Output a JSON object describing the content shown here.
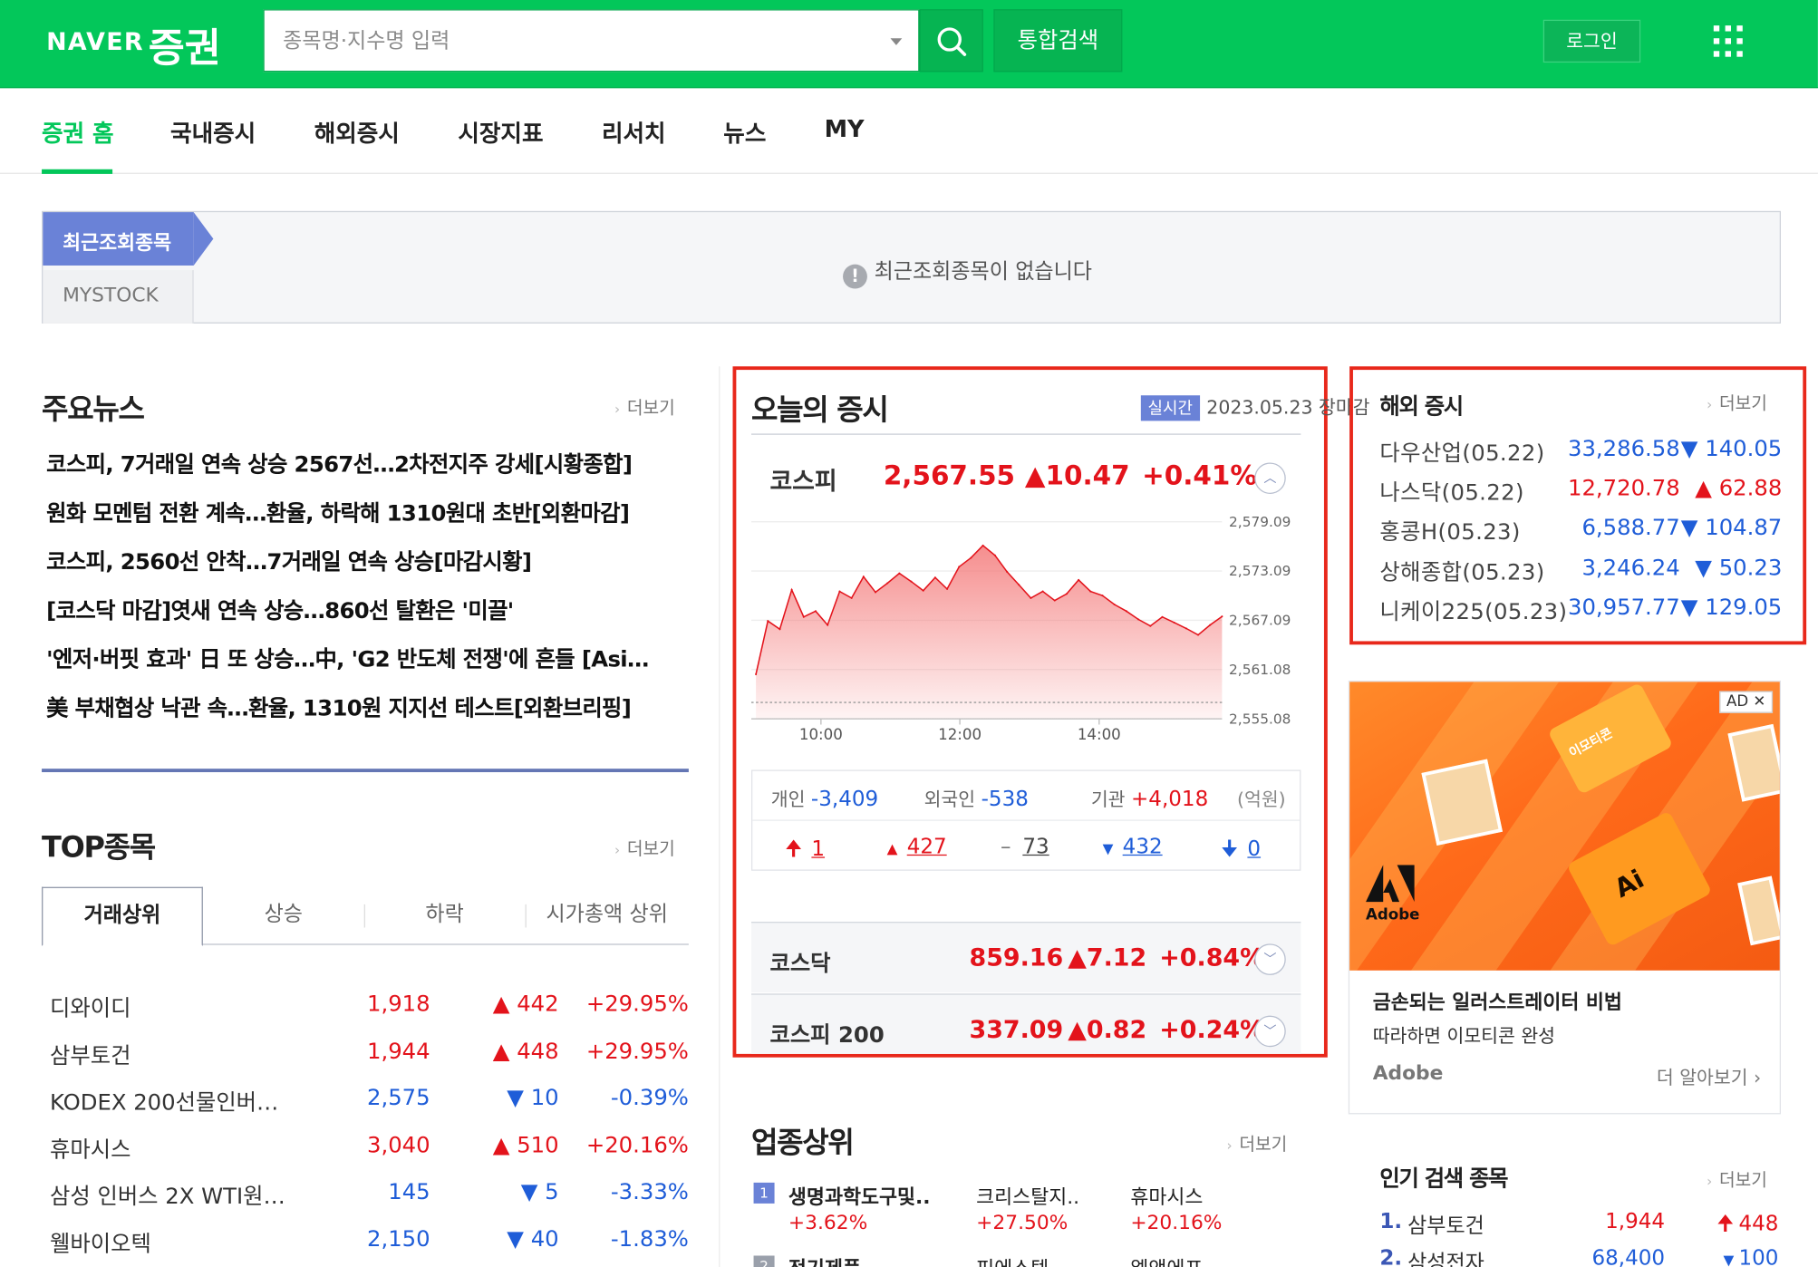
{
  "header": {
    "logo_naver": "NAVER",
    "logo_service": "증권",
    "search_placeholder": "종목명·지수명 입력",
    "integrated_search": "통합검색",
    "login": "로그인"
  },
  "nav": {
    "tabs": [
      "증권 홈",
      "국내증시",
      "해외증시",
      "시장지표",
      "리서치",
      "뉴스",
      "MY"
    ],
    "active": "증권 홈"
  },
  "recent": {
    "tab_recent": "최근조회종목",
    "tab_mystock": "MYSTOCK",
    "empty_message": "최근조회종목이 없습니다"
  },
  "news": {
    "title": "주요뉴스",
    "more": "더보기",
    "items": [
      "코스피, 7거래일 연속 상승 2567선…2차전지주 강세[시황종합]",
      "원화 모멘텀 전환 계속…환율, 하락해 1310원대 초반[외환마감]",
      "코스피, 2560선 안착…7거래일 연속 상승[마감시황]",
      "[코스닥 마감]엿새 연속 상승…860선 탈환은 '미끌'",
      "'엔저·버핏 효과' 日 또 상승…中, 'G2 반도체 전쟁'에 흔들 [Asi…",
      "美 부채협상 낙관 속…환율, 1310원 지지선 테스트[외환브리핑]"
    ]
  },
  "top": {
    "title": "TOP종목",
    "more": "더보기",
    "tabs": [
      "거래상위",
      "상승",
      "하락",
      "시가총액 상위"
    ],
    "rows": [
      {
        "name": "디와이디",
        "price": "1,918",
        "change": "▲ 442",
        "rate": "+29.95%",
        "dir": "up"
      },
      {
        "name": "삼부토건",
        "price": "1,944",
        "change": "▲ 448",
        "rate": "+29.95%",
        "dir": "up"
      },
      {
        "name": "KODEX 200선물인버…",
        "price": "2,575",
        "change": "▼ 10",
        "rate": "-0.39%",
        "dir": "down"
      },
      {
        "name": "휴마시스",
        "price": "3,040",
        "change": "▲ 510",
        "rate": "+20.16%",
        "dir": "up"
      },
      {
        "name": "삼성 인버스 2X WTI원…",
        "price": "145",
        "change": "▼ 5",
        "rate": "-3.33%",
        "dir": "down"
      },
      {
        "name": "웰바이오텍",
        "price": "2,150",
        "change": "▼ 40",
        "rate": "-1.83%",
        "dir": "down"
      }
    ]
  },
  "today": {
    "title": "오늘의 증시",
    "realtime_badge": "실시간",
    "date": "2023.05.23",
    "status": "장마감",
    "kospi": {
      "name": "코스피",
      "value": "2,567.55",
      "change": "▲10.47",
      "rate": "+0.41%"
    },
    "flow": {
      "individual_label": "개인",
      "individual": "-3,409",
      "foreign_label": "외국인",
      "foreign": "-538",
      "institution_label": "기관",
      "institution": "+4,018",
      "unit": "(억원)"
    },
    "counts": {
      "upper_limit": "1",
      "up": "427",
      "flat": "73",
      "down": "432",
      "lower_limit": "0"
    },
    "kosdaq": {
      "name": "코스닥",
      "value": "859.16",
      "change": "▲7.12",
      "rate": "+0.84%"
    },
    "kospi200": {
      "name": "코스피 200",
      "value": "337.09",
      "change": "▲0.82",
      "rate": "+0.24%"
    }
  },
  "chart_data": {
    "type": "area",
    "title": "",
    "x_ticks": [
      "10:00",
      "12:00",
      "14:00"
    ],
    "y_ticks": [
      "2,579.09",
      "2,573.09",
      "2,567.09",
      "2,561.08",
      "2,555.08"
    ],
    "ylim": [
      2555.08,
      2579.09
    ],
    "baseline": 2557.08,
    "x": [
      "09:00",
      "09:10",
      "09:20",
      "09:30",
      "09:40",
      "09:50",
      "10:00",
      "10:10",
      "10:20",
      "10:30",
      "10:40",
      "10:50",
      "11:00",
      "11:10",
      "11:20",
      "11:30",
      "11:40",
      "11:50",
      "12:00",
      "12:10",
      "12:20",
      "12:30",
      "12:40",
      "12:50",
      "13:00",
      "13:10",
      "13:20",
      "13:30",
      "13:40",
      "13:50",
      "14:00",
      "14:10",
      "14:20",
      "14:30",
      "14:40",
      "14:50",
      "15:00",
      "15:10",
      "15:20",
      "15:30"
    ],
    "values": [
      2560.5,
      2567.0,
      2566.0,
      2570.8,
      2567.5,
      2568.2,
      2566.5,
      2570.6,
      2569.8,
      2572.4,
      2570.5,
      2571.6,
      2572.8,
      2571.8,
      2570.7,
      2572.3,
      2570.9,
      2573.6,
      2574.7,
      2576.2,
      2575.0,
      2573.0,
      2571.4,
      2569.8,
      2570.6,
      2569.5,
      2570.3,
      2572.0,
      2570.6,
      2570.1,
      2569.0,
      2568.2,
      2567.2,
      2566.4,
      2567.5,
      2566.8,
      2566.1,
      2565.3,
      2566.5,
      2567.55
    ],
    "grid": true,
    "fill_color": "#f47a7a",
    "line_color": "#e3131b"
  },
  "overseas": {
    "title": "해외 증시",
    "more": "더보기",
    "rows": [
      {
        "name": "다우산업(05.22)",
        "value": "33,286.58",
        "change": "▼ 140.05",
        "dir": "down"
      },
      {
        "name": "나스닥(05.22)",
        "value": "12,720.78",
        "change": "▲ 62.88",
        "dir": "up"
      },
      {
        "name": "홍콩H(05.23)",
        "value": "6,588.77",
        "change": "▼ 104.87",
        "dir": "down"
      },
      {
        "name": "상해종합(05.23)",
        "value": "3,246.24",
        "change": "▼ 50.23",
        "dir": "down"
      },
      {
        "name": "니케이225(05.23)",
        "value": "30,957.77",
        "change": "▼ 129.05",
        "dir": "down"
      }
    ]
  },
  "ad": {
    "badge": "AD",
    "title": "금손되는 일러스트레이터 비법",
    "subtitle": "따라하면 이모티콘 완성",
    "brand": "Adobe",
    "cta": "더 알아보기",
    "logo_text": "Adobe",
    "folder_text": "이모티콘",
    "app_text": "Ai"
  },
  "industry": {
    "title": "업종상위",
    "more": "더보기",
    "items": [
      {
        "rank": "1",
        "name": "생명과학도구및..",
        "rate": "+3.62%"
      },
      {
        "name": "크리스탈지..",
        "rate": "+27.50%"
      },
      {
        "name": "휴마시스",
        "rate": "+20.16%"
      }
    ],
    "row2": [
      {
        "rank": "2",
        "name": "전기제품"
      },
      {
        "name": "피에스텍"
      },
      {
        "name": "엘앤에프"
      }
    ]
  },
  "popular": {
    "title": "인기 검색 종목",
    "more": "더보기",
    "rows": [
      {
        "rank": "1.",
        "name": "삼부토건",
        "price": "1,944",
        "change": "448"
      },
      {
        "rank": "2.",
        "name": "삼성전자",
        "price": "68,400",
        "change": "100"
      }
    ]
  }
}
